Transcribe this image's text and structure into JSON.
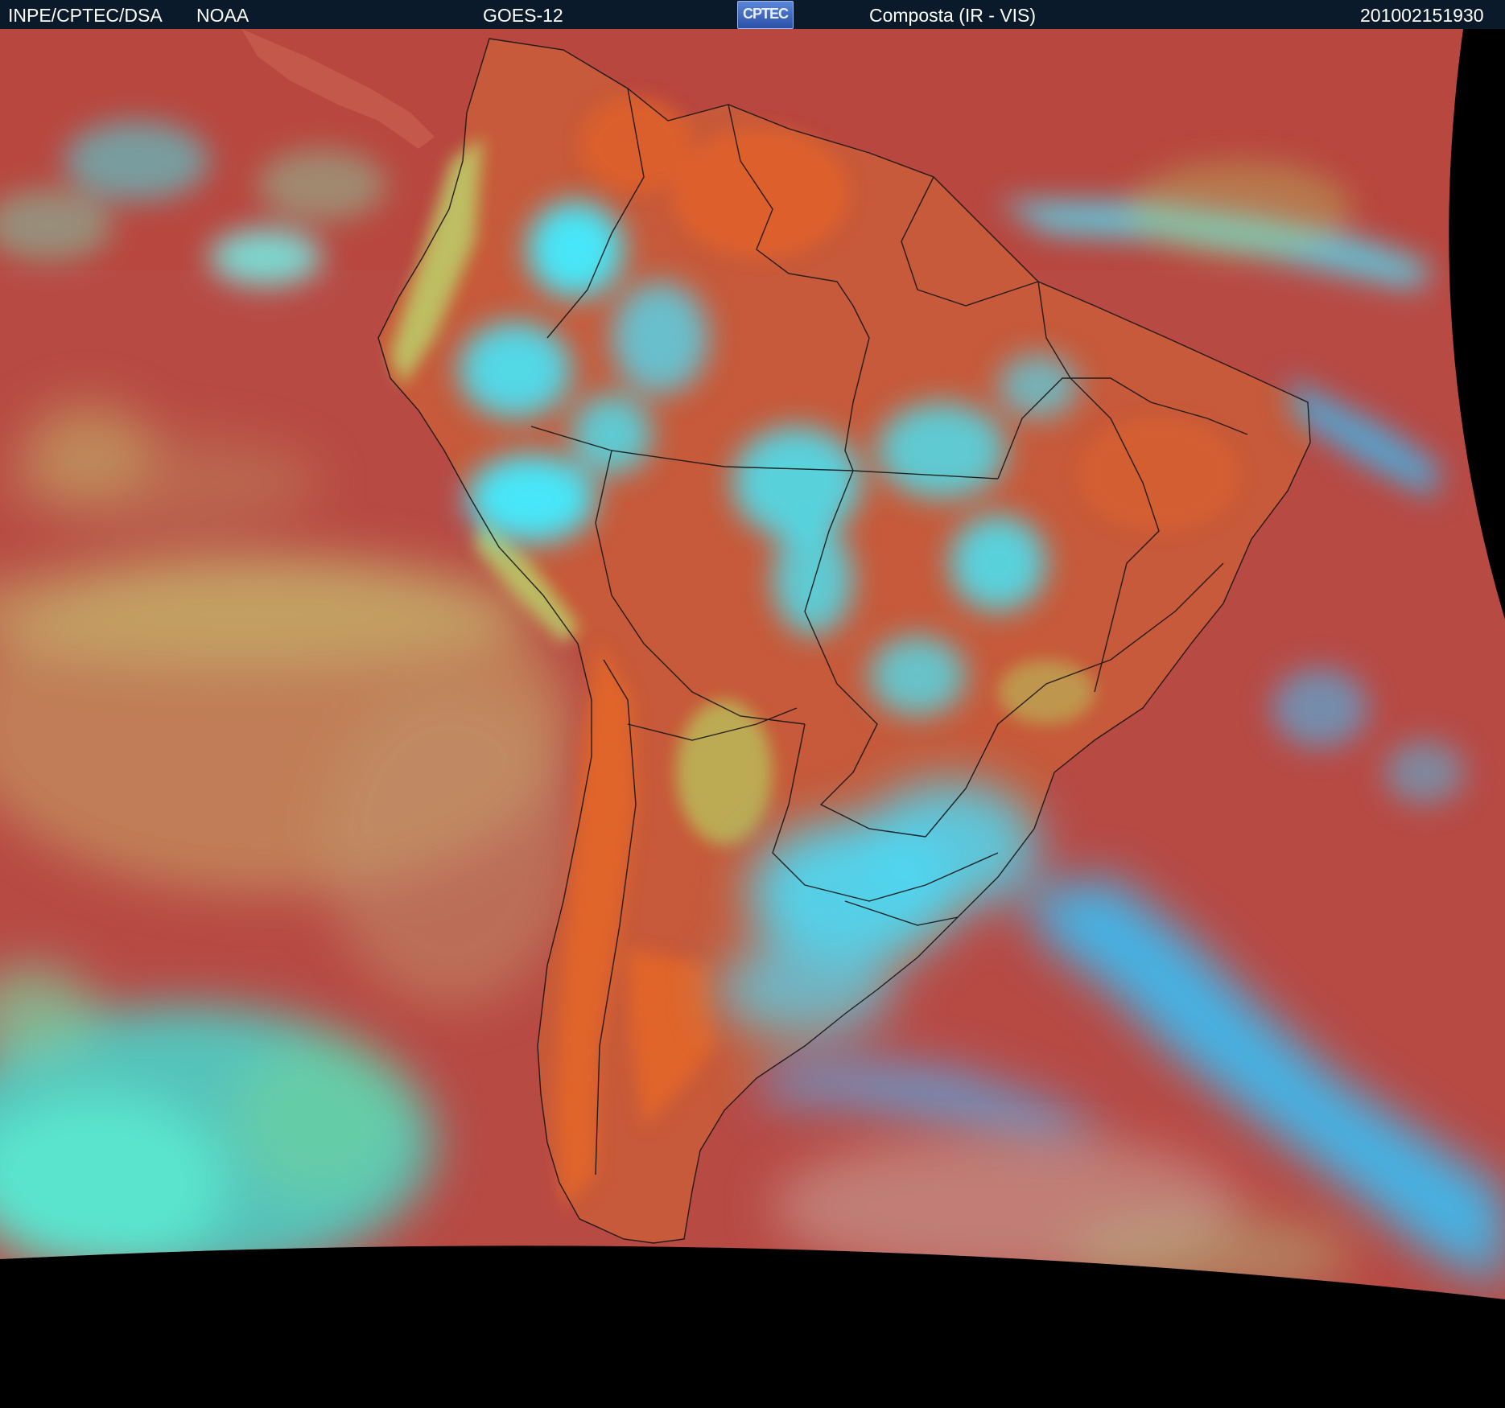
{
  "header": {
    "agency": "INPE/CPTEC/DSA",
    "source": "NOAA",
    "satellite": "GOES-12",
    "logo_text": "CPTEC",
    "product": "Composta (IR - VIS)",
    "timestamp": "201002151930"
  },
  "image": {
    "region": "South America",
    "colors": {
      "background": "#000000",
      "ocean": "#b84a44",
      "land": "#c75a3a",
      "dry_land": "#e0652a",
      "cold_cloud": "#46e6f8",
      "low_cloud": "#b8d260",
      "cloud_band": "#3fb8ee",
      "border_line": "#141414"
    }
  }
}
